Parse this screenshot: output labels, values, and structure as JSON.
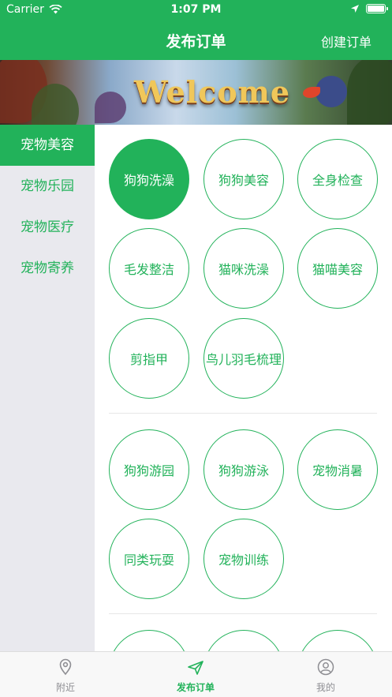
{
  "status_bar": {
    "carrier": "Carrier",
    "time": "1:07 PM"
  },
  "nav": {
    "title": "发布订单",
    "right_action": "创建订单"
  },
  "banner": {
    "text": "Welcome"
  },
  "sidebar": {
    "items": [
      {
        "label": "宠物美容",
        "active": true
      },
      {
        "label": "宠物乐园",
        "active": false
      },
      {
        "label": "宠物医疗",
        "active": false
      },
      {
        "label": "宠物寄养",
        "active": false
      }
    ]
  },
  "services": {
    "grooming": [
      "狗狗洗澡",
      "狗狗美容",
      "全身检查",
      "毛发整洁",
      "猫咪洗澡",
      "猫喵美容",
      "剪指甲",
      "鸟儿羽毛梳理"
    ],
    "park": [
      "狗狗游园",
      "狗狗游泳",
      "宠物消暑",
      "同类玩耍",
      "宠物训练"
    ]
  },
  "selected_service": "狗狗洗澡",
  "tabbar": {
    "items": [
      {
        "label": "附近",
        "icon": "location-pin-icon"
      },
      {
        "label": "发布订单",
        "icon": "paper-plane-icon",
        "active": true
      },
      {
        "label": "我的",
        "icon": "user-icon"
      }
    ]
  },
  "colors": {
    "accent": "#22b25a",
    "sidebar_bg": "#e9e9ee"
  }
}
